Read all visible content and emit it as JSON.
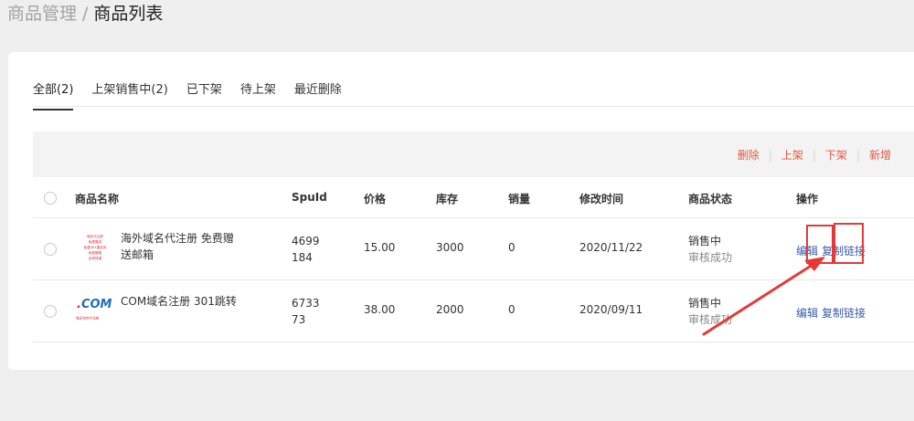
{
  "breadcrumb": {
    "parent": "商品管理",
    "separator": "/",
    "current": "商品列表"
  },
  "tabs": [
    {
      "label": "全部(2)",
      "active": true
    },
    {
      "label": "上架销售中(2)",
      "active": false
    },
    {
      "label": "已下架",
      "active": false
    },
    {
      "label": "待上架",
      "active": false
    },
    {
      "label": "最近删除",
      "active": false
    }
  ],
  "bulk_actions": {
    "delete": "删除",
    "list": "上架",
    "delist": "下架",
    "add": "新增",
    "separator": "|"
  },
  "table": {
    "columns": {
      "name": "商品名称",
      "spuid": "SpuId",
      "price": "价格",
      "stock": "库存",
      "sales": "销量",
      "modified": "修改时间",
      "status": "商品状态",
      "ops": "操作"
    },
    "rows": [
      {
        "thumb_lines": [
          "域名代注册",
          "免费赠送",
          "免费301重定向",
          "免费赠箱",
          "全球快递"
        ],
        "name": "海外域名代注册 免费赠送邮箱",
        "spuid": "4699184",
        "price": "15.00",
        "stock": "3000",
        "sales": "0",
        "modified": "2020/11/22",
        "status": "销售中",
        "review": "审核成功",
        "edit": "编辑",
        "copy_link": "复制链接"
      },
      {
        "thumb_big_dot": ".",
        "thumb_big": "COM",
        "thumb_small": "域名包你代注册",
        "name": "COM域名注册 301跳转",
        "spuid": "673373",
        "price": "38.00",
        "stock": "2000",
        "sales": "0",
        "modified": "2020/09/11",
        "status": "销售中",
        "review": "审核成功",
        "edit": "编辑",
        "copy_link": "复制链接"
      }
    ]
  },
  "colors": {
    "accent": "#e8563f",
    "link": "#3a5ba8",
    "annotation": "#e53935"
  }
}
